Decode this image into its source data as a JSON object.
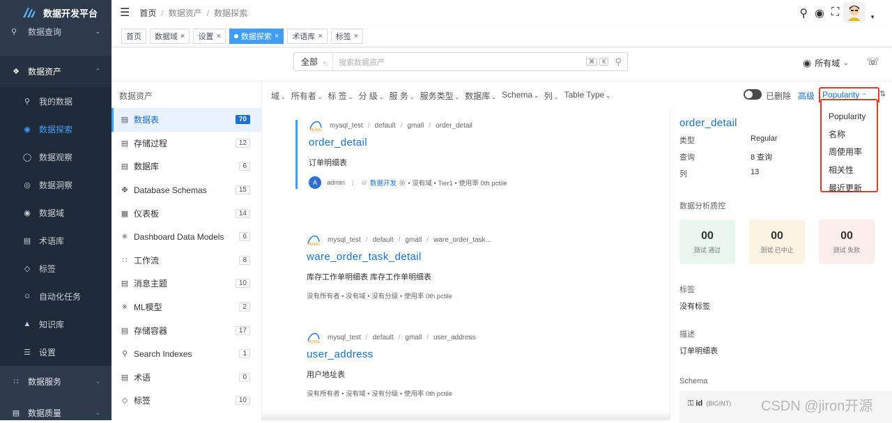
{
  "app": {
    "title": "数据开发平台"
  },
  "sidebar": {
    "top_item": {
      "label": "数据查询"
    },
    "groups": [
      {
        "label": "数据资产",
        "items": [
          {
            "label": "我的数据"
          },
          {
            "label": "数据探索"
          },
          {
            "label": "数据观察"
          },
          {
            "label": "数据洞察"
          },
          {
            "label": "数据域"
          },
          {
            "label": "术语库"
          },
          {
            "label": "标签"
          },
          {
            "label": "自动化任务"
          },
          {
            "label": "知识库"
          },
          {
            "label": "设置"
          }
        ]
      },
      {
        "label": "数据服务"
      },
      {
        "label": "数据质量"
      }
    ]
  },
  "breadcrumb": {
    "items": [
      "首页",
      "数据资产",
      "数据探索"
    ]
  },
  "tabs": [
    "首页",
    "数据域",
    "设置",
    "数据探索",
    "术语库",
    "标签"
  ],
  "search": {
    "scope": "全部",
    "placeholder": "搜索数据资产",
    "shortcut": [
      "⌘",
      "K"
    ]
  },
  "domain_select": "所有域",
  "left_panel": {
    "title": "数据资产",
    "items": [
      {
        "label": "数据表",
        "count": "70"
      },
      {
        "label": "存储过程",
        "count": "12"
      },
      {
        "label": "数据库",
        "count": "6"
      },
      {
        "label": "Database Schemas",
        "count": "15"
      },
      {
        "label": "仪表板",
        "count": "14"
      },
      {
        "label": "Dashboard Data Models",
        "count": "6"
      },
      {
        "label": "工作流",
        "count": "8"
      },
      {
        "label": "消息主题",
        "count": "10"
      },
      {
        "label": "ML模型",
        "count": "2"
      },
      {
        "label": "存储容器",
        "count": "17"
      },
      {
        "label": "Search Indexes",
        "count": "1"
      },
      {
        "label": "术语",
        "count": "0"
      },
      {
        "label": "标签",
        "count": "10"
      }
    ]
  },
  "filters": [
    "域",
    "所有者",
    "标 签",
    "分 级",
    "服 务",
    "服务类型",
    "数据库",
    "Schema",
    "列",
    "Table Type"
  ],
  "toolbar": {
    "deleted": "已删除",
    "advanced": "高级",
    "sort": "Popularity"
  },
  "sort_options": [
    "Popularity",
    "名称",
    "周使用率",
    "相关性",
    "最近更新"
  ],
  "results": [
    {
      "path": [
        "mysql_test",
        "default",
        "gmall",
        "order_detail"
      ],
      "name": "order_detail",
      "desc": "订单明细表",
      "meta": {
        "avatar": "A",
        "owner": "admin",
        "team": "数据开发",
        "rest": "• 没有域 • Tier1 • 使用率 0th pctile"
      }
    },
    {
      "path": [
        "mysql_test",
        "default",
        "gmall",
        "ware_order_task..."
      ],
      "name": "ware_order_task_detail",
      "desc": "库存工作单明细表 库存工作单明细表",
      "meta": {
        "rest": "没有所有者 • 没有域 • 没有分级 • 使用率 0th pctile"
      }
    },
    {
      "path": [
        "mysql_test",
        "default",
        "gmall",
        "user_address"
      ],
      "name": "user_address",
      "desc": "用户地址表",
      "meta": {
        "rest": "没有所有者 • 没有域 • 没有分级 • 使用率 0th pctile"
      }
    }
  ],
  "detail": {
    "title": "order_detail",
    "props": [
      {
        "k": "类型",
        "v": "Regular"
      },
      {
        "k": "查询",
        "v": "8 查询"
      },
      {
        "k": "列",
        "v": "13"
      }
    ],
    "quality_title": "数据分析质控",
    "quality": [
      {
        "n": "00",
        "l": "测试 通过"
      },
      {
        "n": "00",
        "l": "测试 已中止"
      },
      {
        "n": "00",
        "l": "测试 失败"
      }
    ],
    "tags_title": "标签",
    "tags_value": "没有标签",
    "desc_title": "描述",
    "desc_value": "订单明细表",
    "schema_title": "Schema",
    "schema_col": "id",
    "schema_type": "(BIGINT)"
  },
  "watermark": "CSDN @jiron开源"
}
